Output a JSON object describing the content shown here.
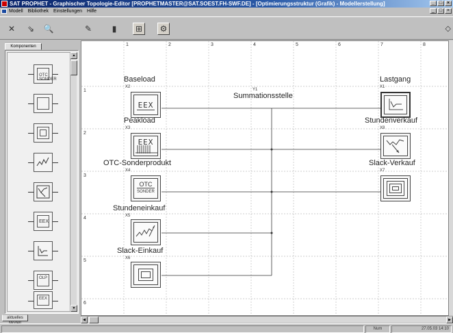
{
  "window": {
    "title": "SAT PROPHET - Graphischer Topologie-Editor [PROPHETMASTER@SAT.SOEST.FH-SWF.DE] - [Optimierungsstruktur (Grafik) - Modellerstellung]",
    "controls": [
      "_",
      "□",
      "×"
    ]
  },
  "menubar": {
    "items": [
      "Modell",
      "Bibliothek",
      "Einstellungen",
      "Hilfe"
    ],
    "controls": [
      "_",
      "□",
      "×"
    ]
  },
  "toolbar": {
    "icons": [
      "delete-icon",
      "open-icon",
      "zoom-icon",
      "edit-icon",
      "save-icon",
      "layout-icon",
      "settings-icon"
    ],
    "glyphs": [
      "✕",
      "⇘",
      "🔍",
      "✎",
      "▮",
      "⊞",
      "⚙"
    ],
    "right_glyph": "◇"
  },
  "left_panel": {
    "tab_top": "Komponenten",
    "tab_bottom": "aktuelles Modell",
    "items": [
      {
        "kind": "otc",
        "label1": "OTC",
        "label2": "SONDER"
      },
      {
        "kind": "box"
      },
      {
        "kind": "box2"
      },
      {
        "kind": "wave"
      },
      {
        "kind": "slack-sell"
      },
      {
        "kind": "eex"
      },
      {
        "kind": "curve"
      },
      {
        "kind": "olp"
      },
      {
        "kind": "eex-bars"
      }
    ],
    "olp_label": "OLP",
    "eex_label": "EEX"
  },
  "canvas": {
    "columns": [
      "1",
      "2",
      "3",
      "4",
      "5",
      "6",
      "7",
      "8"
    ],
    "rows": [
      "1",
      "2",
      "3",
      "4",
      "5",
      "6"
    ],
    "summation": {
      "label": "Summationsstelle",
      "id": "Y1"
    },
    "sources": [
      {
        "name": "Baseload",
        "id": "X2",
        "icon": "EEX"
      },
      {
        "name": "Peakload",
        "id": "X3",
        "icon": "EEX"
      },
      {
        "name": "OTC-Sonderprodukt",
        "id": "X4",
        "icon1": "OTC",
        "icon2": "SONDER"
      },
      {
        "name": "Stundeneinkauf",
        "id": "X5"
      },
      {
        "name": "Slack-Einkauf",
        "id": "X6"
      }
    ],
    "sinks": [
      {
        "name": "Lastgang",
        "id": "X1"
      },
      {
        "name": "Stundenverkauf",
        "id": "X8"
      },
      {
        "name": "Slack-Verkauf",
        "id": "X7"
      }
    ]
  },
  "statusbar": {
    "mode": "Num",
    "datetime": "27.05.03 14:10"
  }
}
